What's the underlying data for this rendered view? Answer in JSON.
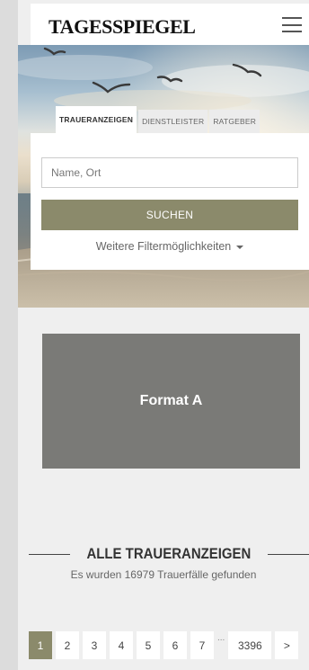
{
  "header": {
    "logo": "TAGESSPIEGEL",
    "menu_icon": "hamburger-menu-icon"
  },
  "tabs": [
    {
      "label": "TRAUERANZEIGEN",
      "active": true
    },
    {
      "label": "DIENSTLEISTER",
      "active": false
    },
    {
      "label": "RATGEBER",
      "active": false
    }
  ],
  "search": {
    "placeholder": "Name, Ort",
    "value": "",
    "button_label": "SUCHEN",
    "more_filters_label": "Weitere Filtermöglichkeiten",
    "more_filters_icon": "caret-down-icon"
  },
  "ad": {
    "label": "Format A"
  },
  "section": {
    "title": "ALLE TRAUERANZEIGEN",
    "result_count": "Es wurden 16979 Trauerfälle gefunden"
  },
  "pagination": {
    "pages": [
      "1",
      "2",
      "3",
      "4",
      "5",
      "6",
      "7"
    ],
    "current": "1",
    "ellipsis": "...",
    "last_page": "3396",
    "next_label": ">"
  },
  "colors": {
    "accent": "#8b8a6b",
    "ad_background": "#7a7a77",
    "page_background": "#efefef"
  }
}
